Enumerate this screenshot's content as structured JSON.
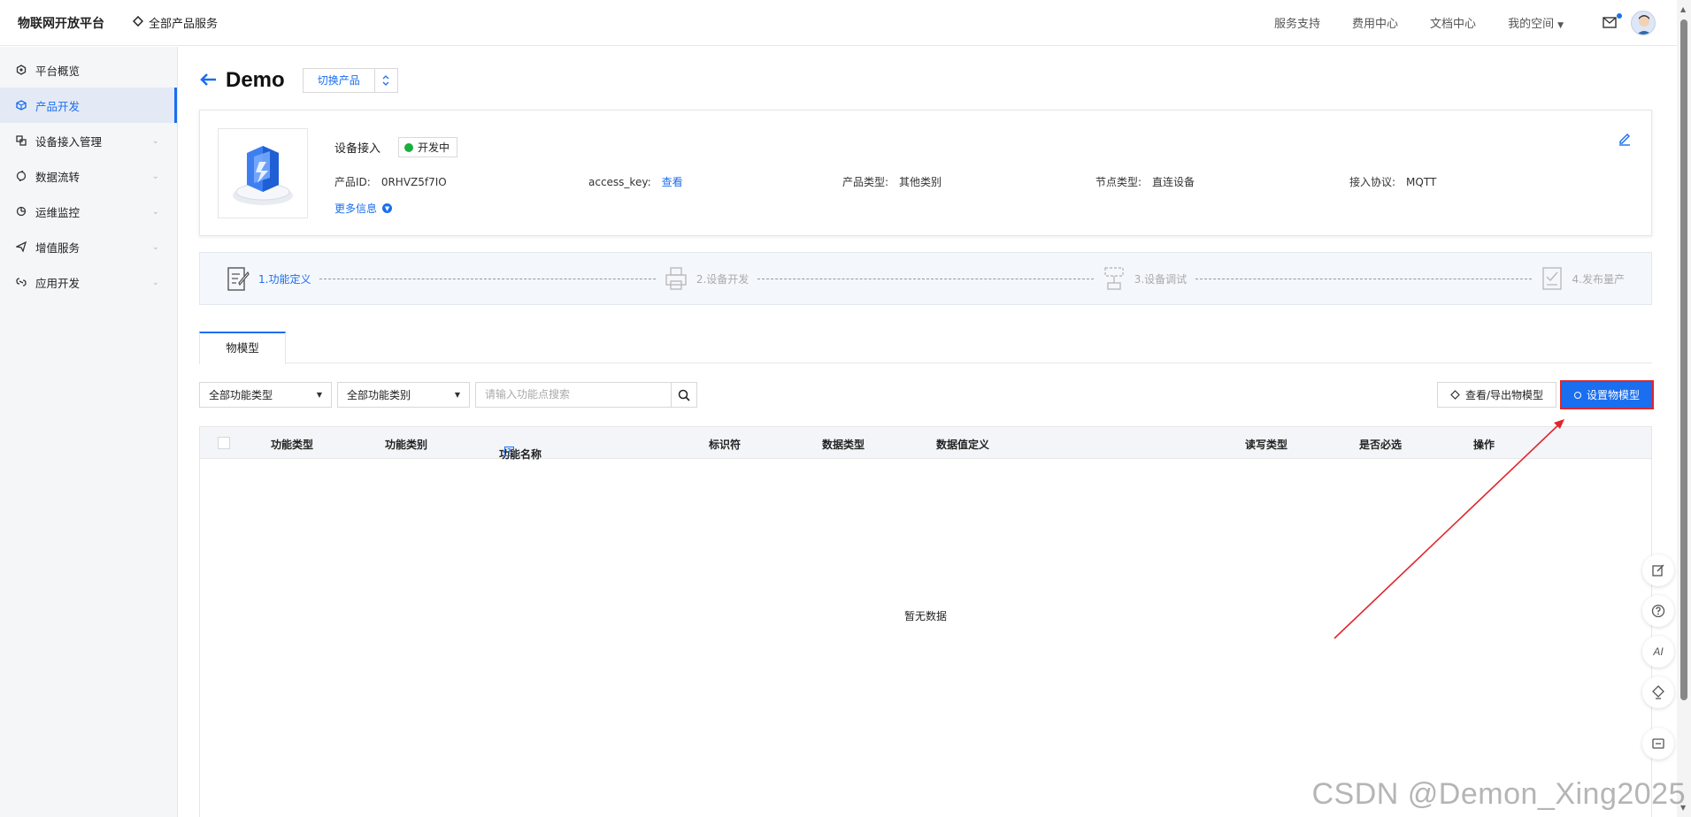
{
  "topbar": {
    "brand": "物联网开放平台",
    "all_products": "全部产品服务",
    "nav": [
      "服务支持",
      "费用中心",
      "文档中心"
    ],
    "my_space": "我的空间"
  },
  "sidebar": {
    "items": [
      {
        "label": "平台概览",
        "icon": "hexagon-icon"
      },
      {
        "label": "产品开发",
        "icon": "cube-icon"
      },
      {
        "label": "设备接入管理",
        "icon": "device-icon"
      },
      {
        "label": "数据流转",
        "icon": "flow-icon"
      },
      {
        "label": "运维监控",
        "icon": "monitor-icon"
      },
      {
        "label": "增值服务",
        "icon": "send-icon"
      },
      {
        "label": "应用开发",
        "icon": "link-icon"
      }
    ]
  },
  "page": {
    "title": "Demo",
    "switch_label": "切换产品"
  },
  "info": {
    "section_title": "设备接入",
    "status": "开发中",
    "product_id_label": "产品ID:",
    "product_id": "0RHVZ5f7IO",
    "access_key_label": "access_key:",
    "access_key_link": "查看",
    "product_type_label": "产品类型:",
    "product_type": "其他类别",
    "node_type_label": "节点类型:",
    "node_type": "直连设备",
    "protocol_label": "接入协议:",
    "protocol": "MQTT",
    "more_info": "更多信息"
  },
  "steps": [
    "1.功能定义",
    "2.设备开发",
    "3.设备调试",
    "4.发布量产"
  ],
  "tabs": [
    "物模型"
  ],
  "filters": {
    "func_type": "全部功能类型",
    "func_category": "全部功能类别",
    "search_placeholder": "请输入功能点搜索"
  },
  "actions": {
    "view_export": "查看/导出物模型",
    "set_model": "设置物模型"
  },
  "table": {
    "columns": [
      "功能类型",
      "功能类别",
      "功能名称",
      "标识符",
      "数据类型",
      "数据值定义",
      "读写类型",
      "是否必选",
      "操作"
    ],
    "empty_text": "暂无数据"
  },
  "float_buttons": [
    "edit-icon",
    "help-icon",
    "AI",
    "service-icon",
    "collapse-icon"
  ],
  "float_ai_label": "AI",
  "watermark": "CSDN @Demon_Xing2025",
  "colors": {
    "primary": "#1a6ef0",
    "highlight_border": "#e0262b",
    "status_green": "#1aad3f"
  }
}
